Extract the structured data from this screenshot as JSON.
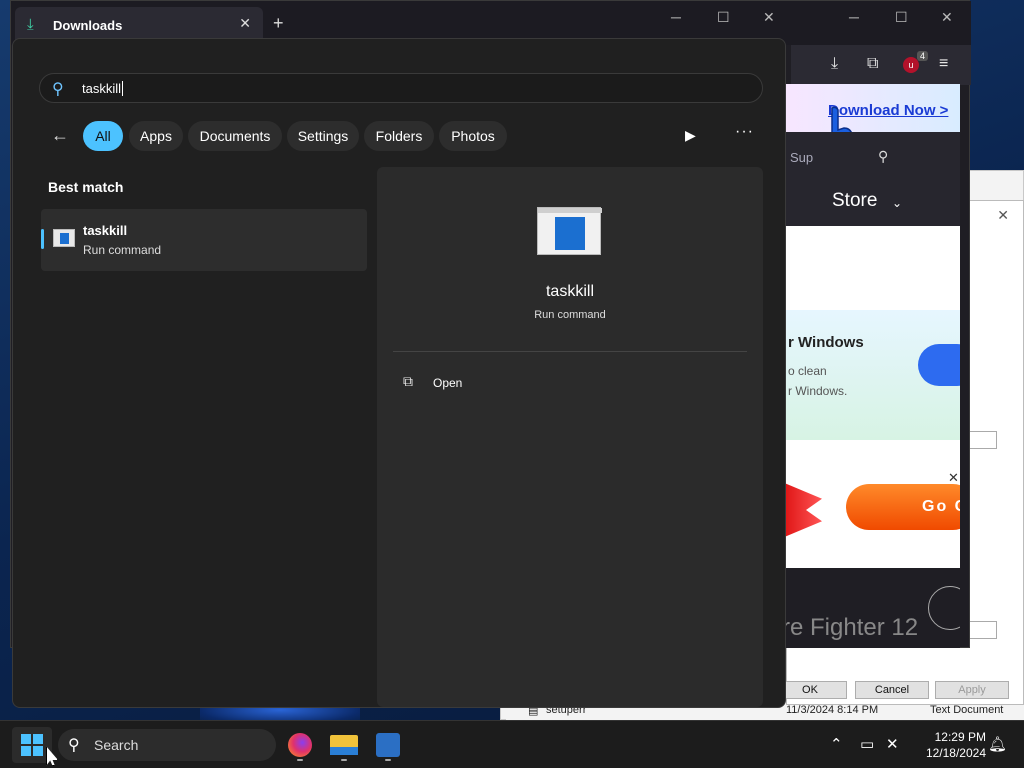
{
  "browser": {
    "tab_title": "Downloads",
    "tab_icon": "download-icon",
    "new_tab": "+",
    "controls": {
      "minimize": "─",
      "maximize": "☐",
      "close": "✕"
    },
    "toolbar": {
      "ext_badge": "4"
    },
    "page": {
      "banner_link": "Download Now >",
      "nav_support": "Sup",
      "nav_store": "Store",
      "promo_title": "r Windows",
      "promo_text1": "o clean",
      "promo_text2": "r Windows.",
      "ad_button": "Go C",
      "bottom_text": "re Fighter 12"
    }
  },
  "back_window": {
    "file_name": "setuperr",
    "file_date": "11/3/2024 8:14 PM",
    "file_type": "Text Document"
  },
  "dialog": {
    "ok_label": "OK",
    "cancel_label": "Cancel",
    "apply_label": "Apply"
  },
  "start_search": {
    "query": "taskkill",
    "filters": [
      {
        "label": "All",
        "active": true
      },
      {
        "label": "Apps",
        "active": false
      },
      {
        "label": "Documents",
        "active": false
      },
      {
        "label": "Settings",
        "active": false
      },
      {
        "label": "Folders",
        "active": false
      },
      {
        "label": "Photos",
        "active": false
      }
    ],
    "best_match_heading": "Best match",
    "result": {
      "name": "taskkill",
      "subtitle": "Run command"
    },
    "detail": {
      "name": "taskkill",
      "subtitle": "Run command",
      "action_open": "Open"
    }
  },
  "taskbar": {
    "search_label": "Search",
    "time": "12:29 PM",
    "date": "12/18/2024",
    "apps": [
      "firefox-icon",
      "file-explorer-icon",
      "wise-cleaner-icon"
    ]
  },
  "colors": {
    "accent": "#4cc2ff",
    "panel_bg": "#202020",
    "detail_bg": "#2b2b2b"
  }
}
